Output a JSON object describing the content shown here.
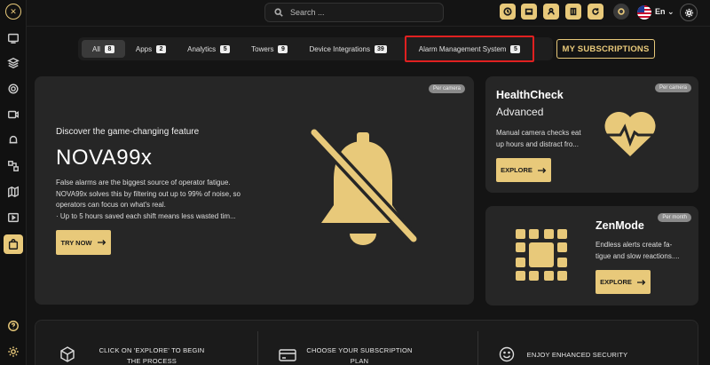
{
  "header": {
    "search_placeholder": "Search ...",
    "language": "En"
  },
  "tabs": [
    {
      "label": "All",
      "count": "8"
    },
    {
      "label": "Apps",
      "count": "2"
    },
    {
      "label": "Analytics",
      "count": "5"
    },
    {
      "label": "Towers",
      "count": "9"
    },
    {
      "label": "Device Integrations",
      "count": "39"
    },
    {
      "label": "Alarm Management System",
      "count": "5"
    }
  ],
  "my_subscriptions_label": "MY SUBSCRIPTIONS",
  "featured": {
    "pill": "Per camera",
    "tagline": "Discover the game-changing feature",
    "title": "NOVA99x",
    "desc_line1": "False alarms are the biggest source of operator fatigue.",
    "desc_line2": "NOVA99x solves this by filtering out up to 99% of noise, so",
    "desc_line3": "operators can focus on what's real.",
    "desc_line4": "· Up to 5 hours saved each shift means less wasted tim...",
    "button": "TRY NOW",
    "icon": "bell-off-icon"
  },
  "healthcheck": {
    "pill": "Per camera",
    "title": "HealthCheck",
    "subtitle": "Advanced",
    "desc_line1": "Manual camera checks eat",
    "desc_line2": "up hours and distract fro...",
    "button": "EXPLORE",
    "icon": "heart-pulse-icon"
  },
  "zenmode": {
    "pill": "Per month",
    "title": "ZenMode",
    "desc_line1": "Endless alerts create fa-",
    "desc_line2": "tigue and slow reactions....",
    "button": "EXPLORE",
    "icon": "chip-grid-icon"
  },
  "steps": [
    {
      "line1": "CLICK ON 'EXPLORE' TO BEGIN",
      "line2": "THE PROCESS",
      "icon": "box-icon"
    },
    {
      "line1": "CHOOSE YOUR SUBSCRIPTION",
      "line2": "PLAN",
      "icon": "card-icon"
    },
    {
      "line1": "ENJOY ENHANCED SECURITY",
      "line2": "",
      "icon": "smile-icon"
    }
  ],
  "colors": {
    "accent": "#e8c97a",
    "background": "#141414",
    "card": "#262626",
    "highlight": "#e02020"
  }
}
